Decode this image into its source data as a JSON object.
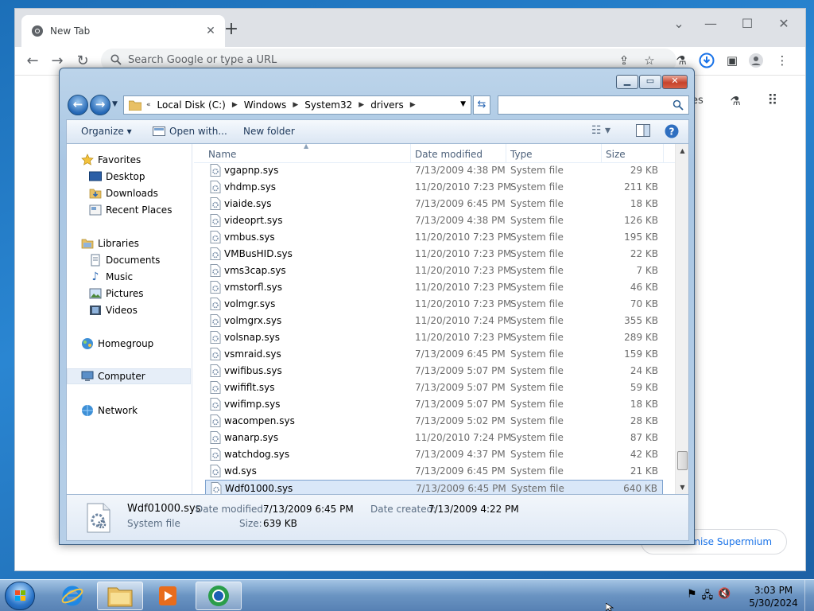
{
  "browser": {
    "tab_title": "New Tab",
    "omnibox_placeholder": "Search Google or type a URL",
    "ntp_partial_label": "es",
    "customise_label": "omise Supermium"
  },
  "dialog": {
    "address": [
      "Local Disk (C:)",
      "Windows",
      "System32",
      "drivers"
    ],
    "address_prefix": "«",
    "search_value": "",
    "toolbar": {
      "organize": "Organize",
      "open_with": "Open with...",
      "new_folder": "New folder"
    },
    "nav": {
      "favorites": "Favorites",
      "desktop": "Desktop",
      "downloads": "Downloads",
      "recent_places": "Recent Places",
      "libraries": "Libraries",
      "documents": "Documents",
      "music": "Music",
      "pictures": "Pictures",
      "videos": "Videos",
      "homegroup": "Homegroup",
      "computer": "Computer",
      "network": "Network"
    },
    "columns": {
      "name": "Name",
      "date_modified": "Date modified",
      "type": "Type",
      "size": "Size"
    },
    "files": [
      {
        "name": "vgapnp.sys",
        "date": "7/13/2009 4:38 PM",
        "type": "System file",
        "size": "29 KB"
      },
      {
        "name": "vhdmp.sys",
        "date": "11/20/2010 7:23 PM",
        "type": "System file",
        "size": "211 KB"
      },
      {
        "name": "viaide.sys",
        "date": "7/13/2009 6:45 PM",
        "type": "System file",
        "size": "18 KB"
      },
      {
        "name": "videoprt.sys",
        "date": "7/13/2009 4:38 PM",
        "type": "System file",
        "size": "126 KB"
      },
      {
        "name": "vmbus.sys",
        "date": "11/20/2010 7:23 PM",
        "type": "System file",
        "size": "195 KB"
      },
      {
        "name": "VMBusHID.sys",
        "date": "11/20/2010 7:23 PM",
        "type": "System file",
        "size": "22 KB"
      },
      {
        "name": "vms3cap.sys",
        "date": "11/20/2010 7:23 PM",
        "type": "System file",
        "size": "7 KB"
      },
      {
        "name": "vmstorfl.sys",
        "date": "11/20/2010 7:23 PM",
        "type": "System file",
        "size": "46 KB"
      },
      {
        "name": "volmgr.sys",
        "date": "11/20/2010 7:23 PM",
        "type": "System file",
        "size": "70 KB"
      },
      {
        "name": "volmgrx.sys",
        "date": "11/20/2010 7:24 PM",
        "type": "System file",
        "size": "355 KB"
      },
      {
        "name": "volsnap.sys",
        "date": "11/20/2010 7:23 PM",
        "type": "System file",
        "size": "289 KB"
      },
      {
        "name": "vsmraid.sys",
        "date": "7/13/2009 6:45 PM",
        "type": "System file",
        "size": "159 KB"
      },
      {
        "name": "vwifibus.sys",
        "date": "7/13/2009 5:07 PM",
        "type": "System file",
        "size": "24 KB"
      },
      {
        "name": "vwififlt.sys",
        "date": "7/13/2009 5:07 PM",
        "type": "System file",
        "size": "59 KB"
      },
      {
        "name": "vwifimp.sys",
        "date": "7/13/2009 5:07 PM",
        "type": "System file",
        "size": "18 KB"
      },
      {
        "name": "wacompen.sys",
        "date": "7/13/2009 5:02 PM",
        "type": "System file",
        "size": "28 KB"
      },
      {
        "name": "wanarp.sys",
        "date": "11/20/2010 7:24 PM",
        "type": "System file",
        "size": "87 KB"
      },
      {
        "name": "watchdog.sys",
        "date": "7/13/2009 4:37 PM",
        "type": "System file",
        "size": "42 KB"
      },
      {
        "name": "wd.sys",
        "date": "7/13/2009 6:45 PM",
        "type": "System file",
        "size": "21 KB"
      },
      {
        "name": "Wdf01000.sys",
        "date": "7/13/2009 6:45 PM",
        "type": "System file",
        "size": "640 KB"
      }
    ],
    "selected_index": 19,
    "details": {
      "name": "Wdf01000.sys",
      "type": "System file",
      "date_modified_label": "Date modified:",
      "date_modified": "7/13/2009 6:45 PM",
      "date_created_label": "Date created:",
      "date_created": "7/13/2009 4:22 PM",
      "size_label": "Size:",
      "size": "639 KB"
    }
  },
  "taskbar": {
    "time": "3:03 PM",
    "date": "5/30/2024"
  },
  "colors": {
    "selection": "#d9e7f8",
    "accent": "#2a74c8"
  }
}
